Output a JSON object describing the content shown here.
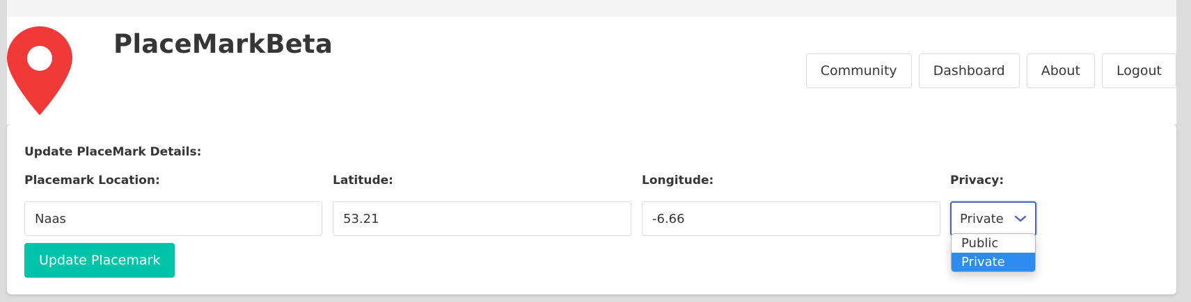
{
  "app": {
    "title": "PlaceMarkBeta"
  },
  "nav": {
    "items": [
      "Community",
      "Dashboard",
      "About",
      "Logout"
    ]
  },
  "form": {
    "heading": "Update PlaceMark Details:",
    "location": {
      "label": "Placemark Location:",
      "value": "Naas"
    },
    "latitude": {
      "label": "Latitude:",
      "value": "53.21"
    },
    "longitude": {
      "label": "Longitude:",
      "value": "-6.66"
    },
    "privacy": {
      "label": "Privacy:",
      "value": "Private",
      "options": [
        "Public",
        "Private"
      ],
      "selected_option": "Private"
    },
    "submit_label": "Update Placemark"
  },
  "icons": {
    "logo": "map-pin-icon",
    "select_arrow": "chevron-down-icon"
  },
  "colors": {
    "logo_red": "#f03a3a",
    "primary_teal": "#00c4a7",
    "focus_blue": "#485fc7",
    "option_highlight": "#2d8cf0"
  }
}
